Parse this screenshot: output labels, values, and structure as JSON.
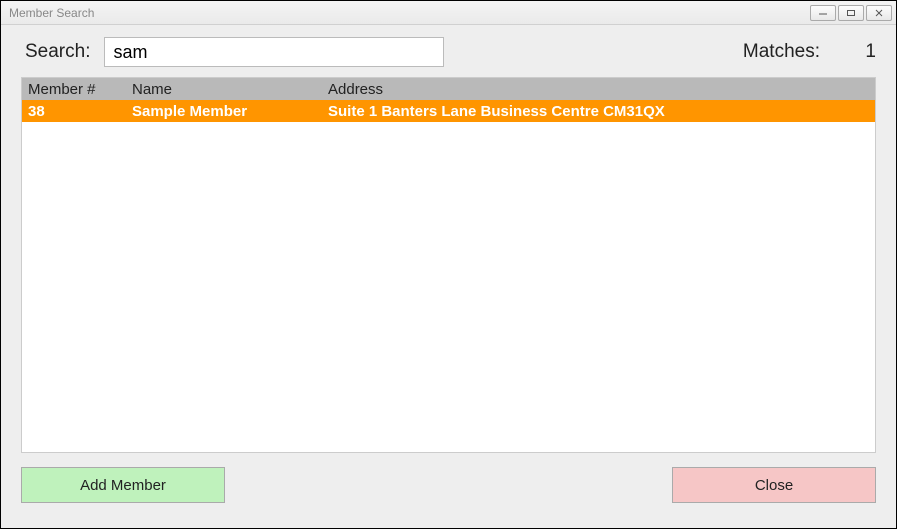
{
  "window": {
    "title": "Member Search"
  },
  "search": {
    "label": "Search:",
    "value": "sam",
    "matches_label": "Matches:",
    "matches_count": "1"
  },
  "table": {
    "headers": {
      "member_no": "Member #",
      "name": "Name",
      "address": "Address"
    },
    "rows": [
      {
        "member_no": "38",
        "name": "Sample Member",
        "address": "Suite 1 Banters Lane Business Centre CM31QX"
      }
    ]
  },
  "buttons": {
    "add_member": "Add Member",
    "close": "Close"
  }
}
